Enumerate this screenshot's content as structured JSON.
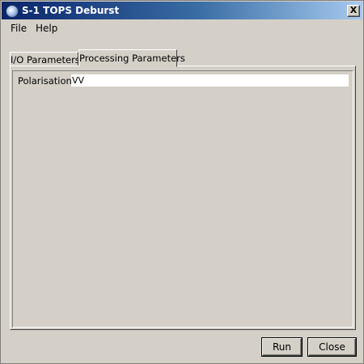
{
  "window": {
    "title": "S-1 TOPS Deburst",
    "close_glyph": "X"
  },
  "menu": {
    "items": [
      {
        "label": "File"
      },
      {
        "label": "Help"
      }
    ]
  },
  "tabs": [
    {
      "label": "I/O Parameters",
      "active": false
    },
    {
      "label": "Processing Parameters",
      "active": true
    }
  ],
  "processing": {
    "polarisations_label": "Polarisations:",
    "polarisations_value": "VV"
  },
  "buttons": {
    "run_label": "Run",
    "close_label": "Close"
  },
  "icons": {
    "app": "globe-icon",
    "close": "close-icon"
  },
  "colors": {
    "titlebar_start": "#0a246a",
    "titlebar_end": "#a6caf0",
    "background": "#d4d0c8",
    "field": "#ffffff"
  }
}
